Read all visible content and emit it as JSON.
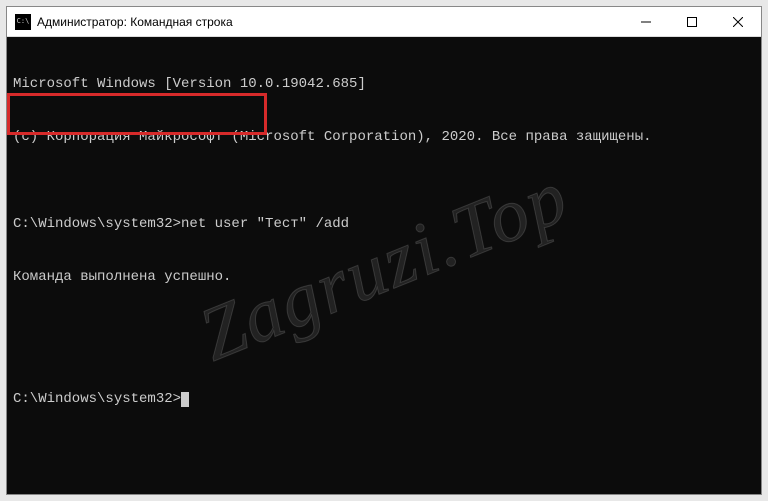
{
  "titlebar": {
    "title": "Администратор: Командная строка"
  },
  "terminal": {
    "line1": "Microsoft Windows [Version 10.0.19042.685]",
    "line2": "(c) Корпорация Майкрософт (Microsoft Corporation), 2020. Все права защищены.",
    "blank1": "",
    "line3": "C:\\Windows\\system32>net user \"Тест\" /add",
    "line4": "Команда выполнена успешно.",
    "blank2": "",
    "blank3": "",
    "prompt": "C:\\Windows\\system32>"
  },
  "watermark": "Zagruzi.Top",
  "highlight": {
    "present": true
  }
}
